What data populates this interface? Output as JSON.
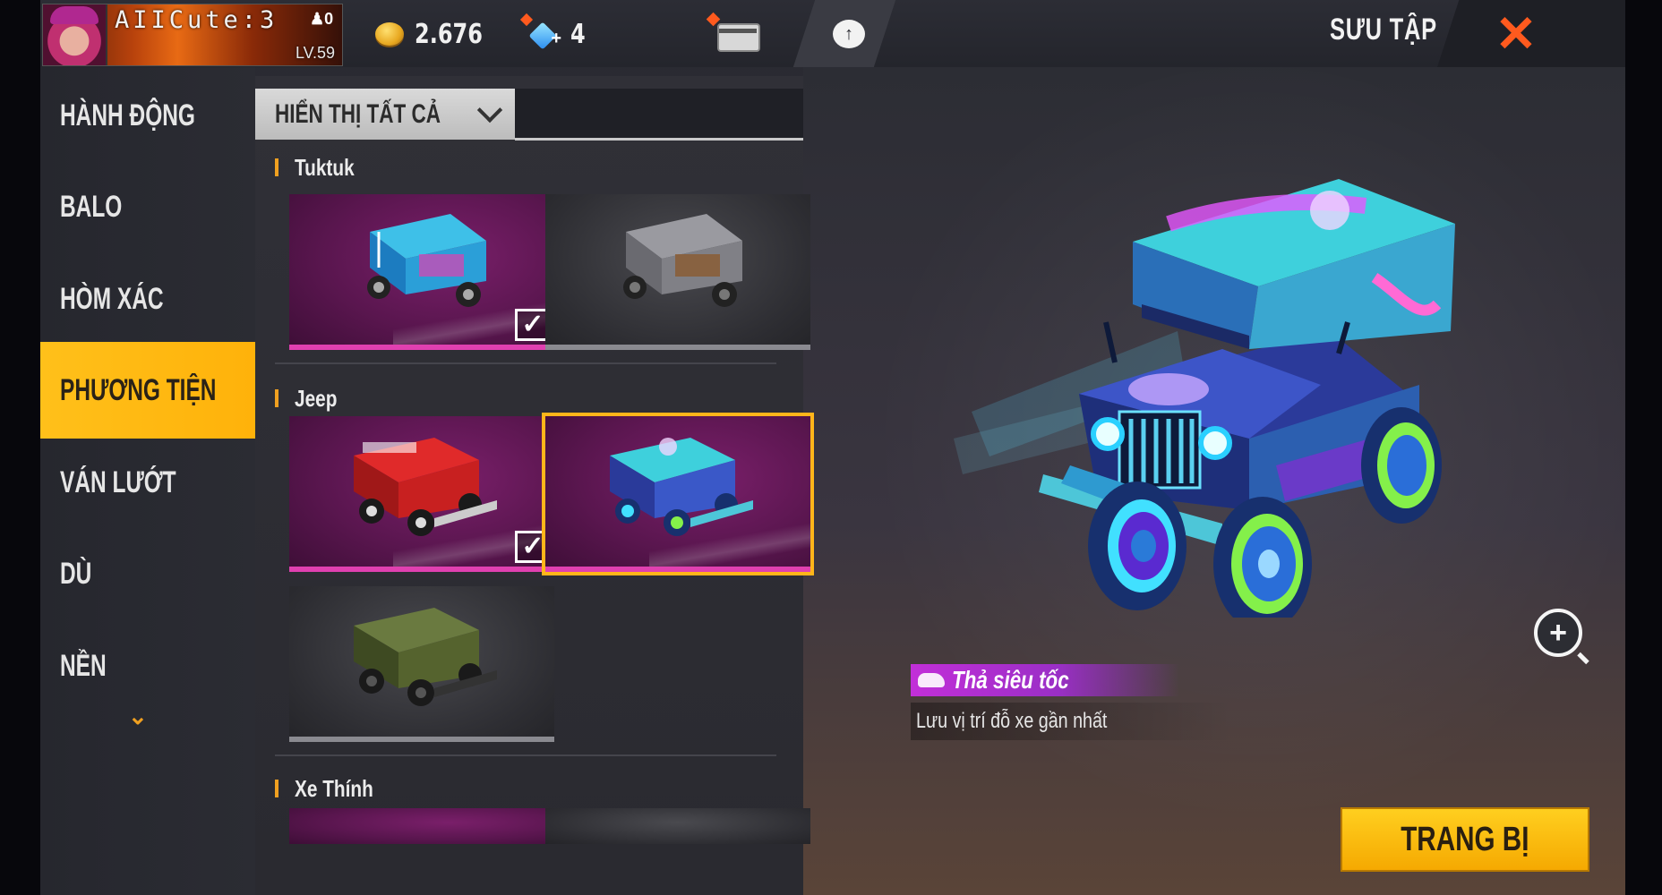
{
  "player": {
    "name": "AIICute:3",
    "likes": "0",
    "level": "LV.59",
    "avatar_icon": "player-avatar"
  },
  "currency": {
    "coins": "2.676",
    "coin_icon": "gold-coin-icon",
    "diamonds": "4",
    "diamond_icon": "diamond-plus-icon"
  },
  "header": {
    "title": "SƯU TẬP",
    "close_icon": "close-x-icon",
    "cloud_icon": "cloud-upload-icon",
    "card_icon": "diamond-card-icon"
  },
  "sidebar": {
    "items": [
      {
        "label": "HÀNH ĐỘNG"
      },
      {
        "label": "BALO"
      },
      {
        "label": "HÒM XÁC"
      },
      {
        "label": "PHƯƠNG TIỆN"
      },
      {
        "label": "VÁN LƯỚT"
      },
      {
        "label": "DÙ"
      },
      {
        "label": "NỀN"
      }
    ],
    "active": "PHƯƠNG TIỆN",
    "more_icon": "chevron-down-icon"
  },
  "filter": {
    "label": "HIỂN THỊ TẤT CẢ"
  },
  "sections": [
    {
      "title": "Tuktuk"
    },
    {
      "title": "Jeep"
    },
    {
      "title": "Xe Thính"
    }
  ],
  "detail": {
    "skill_name": "Thả siêu tốc",
    "skill_description": "Lưu vị trí đỗ xe gần nhất",
    "equip_label": "TRANG BỊ",
    "zoom_icon": "zoom-in-icon"
  },
  "colors": {
    "accent": "#ffb51a",
    "close": "#ff5a1e",
    "skill": "#c22fd8",
    "tile_purple": "#5a164f"
  }
}
